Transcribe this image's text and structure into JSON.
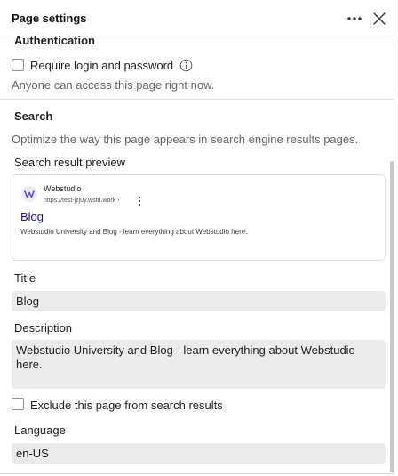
{
  "header": {
    "title": "Page settings",
    "menu_icon": "ellipsis-icon",
    "close_icon": "close-icon"
  },
  "authentication": {
    "heading": "Authentication",
    "require_login_label": "Require login and password",
    "require_login_checked": false,
    "info_icon": "info-icon",
    "hint": "Anyone can access this page right now."
  },
  "search": {
    "heading": "Search",
    "hint": "Optimize the way this page appears in search engine results pages.",
    "preview_label": "Search result preview",
    "preview": {
      "site_name": "Webstudio",
      "url": "https://test-jzj0y.wstd.work ›",
      "title": "Blog",
      "description": "Webstudio University and Blog - learn everything about Webstudio here."
    },
    "title_label": "Title",
    "title_value": "Blog",
    "description_label": "Description",
    "description_value": "Webstudio University and Blog - learn everything about Webstudio here.",
    "exclude_label": "Exclude this page from search results",
    "exclude_checked": false,
    "language_label": "Language",
    "language_value": "en-US"
  },
  "colors": {
    "link": "#1a0dab",
    "field_bg": "#ebebeb",
    "brand": "#6a48e0"
  }
}
